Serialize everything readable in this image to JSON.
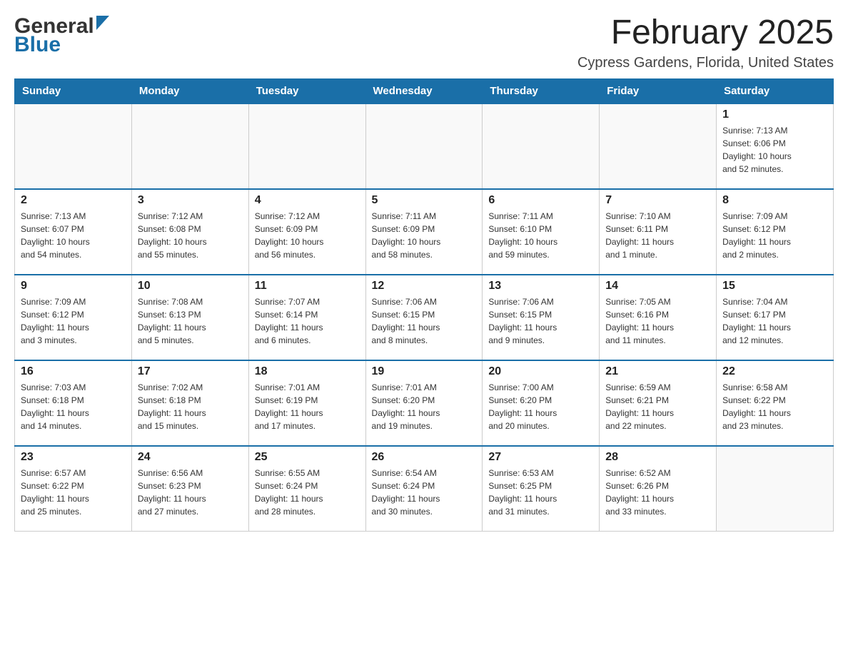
{
  "logo": {
    "general": "General",
    "blue": "Blue"
  },
  "title": {
    "month_year": "February 2025",
    "location": "Cypress Gardens, Florida, United States"
  },
  "weekdays": [
    "Sunday",
    "Monday",
    "Tuesday",
    "Wednesday",
    "Thursday",
    "Friday",
    "Saturday"
  ],
  "weeks": [
    [
      {
        "day": "",
        "info": ""
      },
      {
        "day": "",
        "info": ""
      },
      {
        "day": "",
        "info": ""
      },
      {
        "day": "",
        "info": ""
      },
      {
        "day": "",
        "info": ""
      },
      {
        "day": "",
        "info": ""
      },
      {
        "day": "1",
        "info": "Sunrise: 7:13 AM\nSunset: 6:06 PM\nDaylight: 10 hours\nand 52 minutes."
      }
    ],
    [
      {
        "day": "2",
        "info": "Sunrise: 7:13 AM\nSunset: 6:07 PM\nDaylight: 10 hours\nand 54 minutes."
      },
      {
        "day": "3",
        "info": "Sunrise: 7:12 AM\nSunset: 6:08 PM\nDaylight: 10 hours\nand 55 minutes."
      },
      {
        "day": "4",
        "info": "Sunrise: 7:12 AM\nSunset: 6:09 PM\nDaylight: 10 hours\nand 56 minutes."
      },
      {
        "day": "5",
        "info": "Sunrise: 7:11 AM\nSunset: 6:09 PM\nDaylight: 10 hours\nand 58 minutes."
      },
      {
        "day": "6",
        "info": "Sunrise: 7:11 AM\nSunset: 6:10 PM\nDaylight: 10 hours\nand 59 minutes."
      },
      {
        "day": "7",
        "info": "Sunrise: 7:10 AM\nSunset: 6:11 PM\nDaylight: 11 hours\nand 1 minute."
      },
      {
        "day": "8",
        "info": "Sunrise: 7:09 AM\nSunset: 6:12 PM\nDaylight: 11 hours\nand 2 minutes."
      }
    ],
    [
      {
        "day": "9",
        "info": "Sunrise: 7:09 AM\nSunset: 6:12 PM\nDaylight: 11 hours\nand 3 minutes."
      },
      {
        "day": "10",
        "info": "Sunrise: 7:08 AM\nSunset: 6:13 PM\nDaylight: 11 hours\nand 5 minutes."
      },
      {
        "day": "11",
        "info": "Sunrise: 7:07 AM\nSunset: 6:14 PM\nDaylight: 11 hours\nand 6 minutes."
      },
      {
        "day": "12",
        "info": "Sunrise: 7:06 AM\nSunset: 6:15 PM\nDaylight: 11 hours\nand 8 minutes."
      },
      {
        "day": "13",
        "info": "Sunrise: 7:06 AM\nSunset: 6:15 PM\nDaylight: 11 hours\nand 9 minutes."
      },
      {
        "day": "14",
        "info": "Sunrise: 7:05 AM\nSunset: 6:16 PM\nDaylight: 11 hours\nand 11 minutes."
      },
      {
        "day": "15",
        "info": "Sunrise: 7:04 AM\nSunset: 6:17 PM\nDaylight: 11 hours\nand 12 minutes."
      }
    ],
    [
      {
        "day": "16",
        "info": "Sunrise: 7:03 AM\nSunset: 6:18 PM\nDaylight: 11 hours\nand 14 minutes."
      },
      {
        "day": "17",
        "info": "Sunrise: 7:02 AM\nSunset: 6:18 PM\nDaylight: 11 hours\nand 15 minutes."
      },
      {
        "day": "18",
        "info": "Sunrise: 7:01 AM\nSunset: 6:19 PM\nDaylight: 11 hours\nand 17 minutes."
      },
      {
        "day": "19",
        "info": "Sunrise: 7:01 AM\nSunset: 6:20 PM\nDaylight: 11 hours\nand 19 minutes."
      },
      {
        "day": "20",
        "info": "Sunrise: 7:00 AM\nSunset: 6:20 PM\nDaylight: 11 hours\nand 20 minutes."
      },
      {
        "day": "21",
        "info": "Sunrise: 6:59 AM\nSunset: 6:21 PM\nDaylight: 11 hours\nand 22 minutes."
      },
      {
        "day": "22",
        "info": "Sunrise: 6:58 AM\nSunset: 6:22 PM\nDaylight: 11 hours\nand 23 minutes."
      }
    ],
    [
      {
        "day": "23",
        "info": "Sunrise: 6:57 AM\nSunset: 6:22 PM\nDaylight: 11 hours\nand 25 minutes."
      },
      {
        "day": "24",
        "info": "Sunrise: 6:56 AM\nSunset: 6:23 PM\nDaylight: 11 hours\nand 27 minutes."
      },
      {
        "day": "25",
        "info": "Sunrise: 6:55 AM\nSunset: 6:24 PM\nDaylight: 11 hours\nand 28 minutes."
      },
      {
        "day": "26",
        "info": "Sunrise: 6:54 AM\nSunset: 6:24 PM\nDaylight: 11 hours\nand 30 minutes."
      },
      {
        "day": "27",
        "info": "Sunrise: 6:53 AM\nSunset: 6:25 PM\nDaylight: 11 hours\nand 31 minutes."
      },
      {
        "day": "28",
        "info": "Sunrise: 6:52 AM\nSunset: 6:26 PM\nDaylight: 11 hours\nand 33 minutes."
      },
      {
        "day": "",
        "info": ""
      }
    ]
  ]
}
